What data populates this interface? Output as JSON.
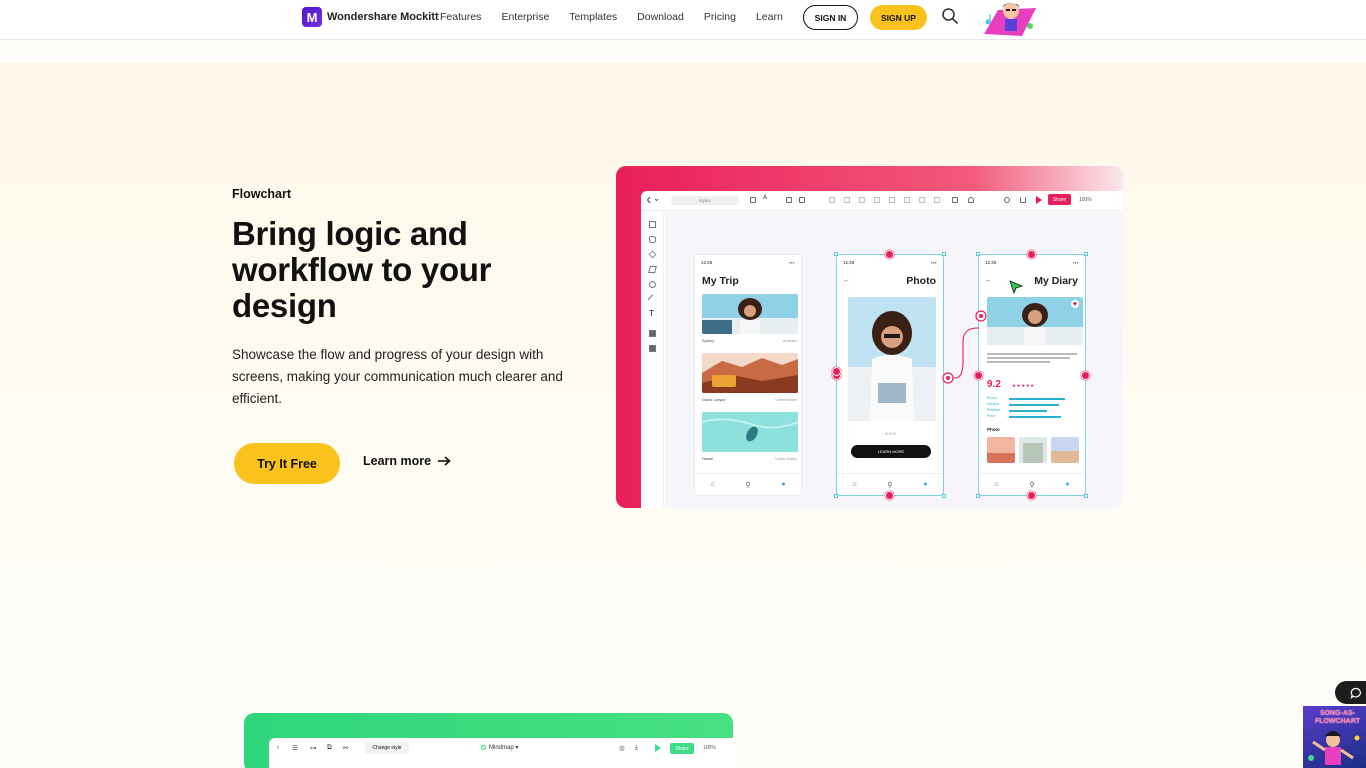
{
  "nav": {
    "brand": "Wondershare Mockitt",
    "brand_mark": "M",
    "items": [
      "Features",
      "Enterprise",
      "Templates",
      "Download",
      "Pricing",
      "Learn"
    ],
    "signin_label": "SIGN IN",
    "signup_label": "SIGN UP"
  },
  "hero": {
    "eyebrow": "Flowchart",
    "headline": "Bring logic and workflow to your design",
    "description": "Showcase the flow and progress of your design with screens, making your communication much clearer and efficient.",
    "cta_primary": "Try It Free",
    "cta_secondary": "Learn more"
  },
  "preview": {
    "toolbar": {
      "doc_name": "style1",
      "share_label": "Share",
      "zoom": "100%"
    },
    "screens": [
      {
        "time": "12:26",
        "title": "My Trip",
        "captions": [
          {
            "left": "Sydney",
            "right": "Australia"
          },
          {
            "left": "Grand Canyon",
            "right": "United States"
          },
          {
            "left": "Hawaii",
            "right": "United States"
          }
        ]
      },
      {
        "time": "12:26",
        "title": "Photo",
        "button": "LEARN MORE"
      },
      {
        "time": "12:26",
        "title": "My Diary",
        "rating": "9.2",
        "rating_stars": "★★★★★",
        "metrics": [
          "Room",
          "Service",
          "Position",
          "Price"
        ],
        "photo_label": "Photo"
      }
    ]
  },
  "mindmap_preview": {
    "style_label": "Change style",
    "mode_label": "Mindmap",
    "share_label": "Share",
    "zoom": "100%"
  },
  "promo_tile": {
    "text_line1": "SONG-AS-",
    "text_line2": "FLOWCHART"
  },
  "colors": {
    "accent_yellow": "#fbc21d",
    "accent_pink": "#e91e5b",
    "accent_green": "#2fd67b",
    "brand_purple": "#4a17c9",
    "selection_cyan": "#7bd3e6"
  }
}
